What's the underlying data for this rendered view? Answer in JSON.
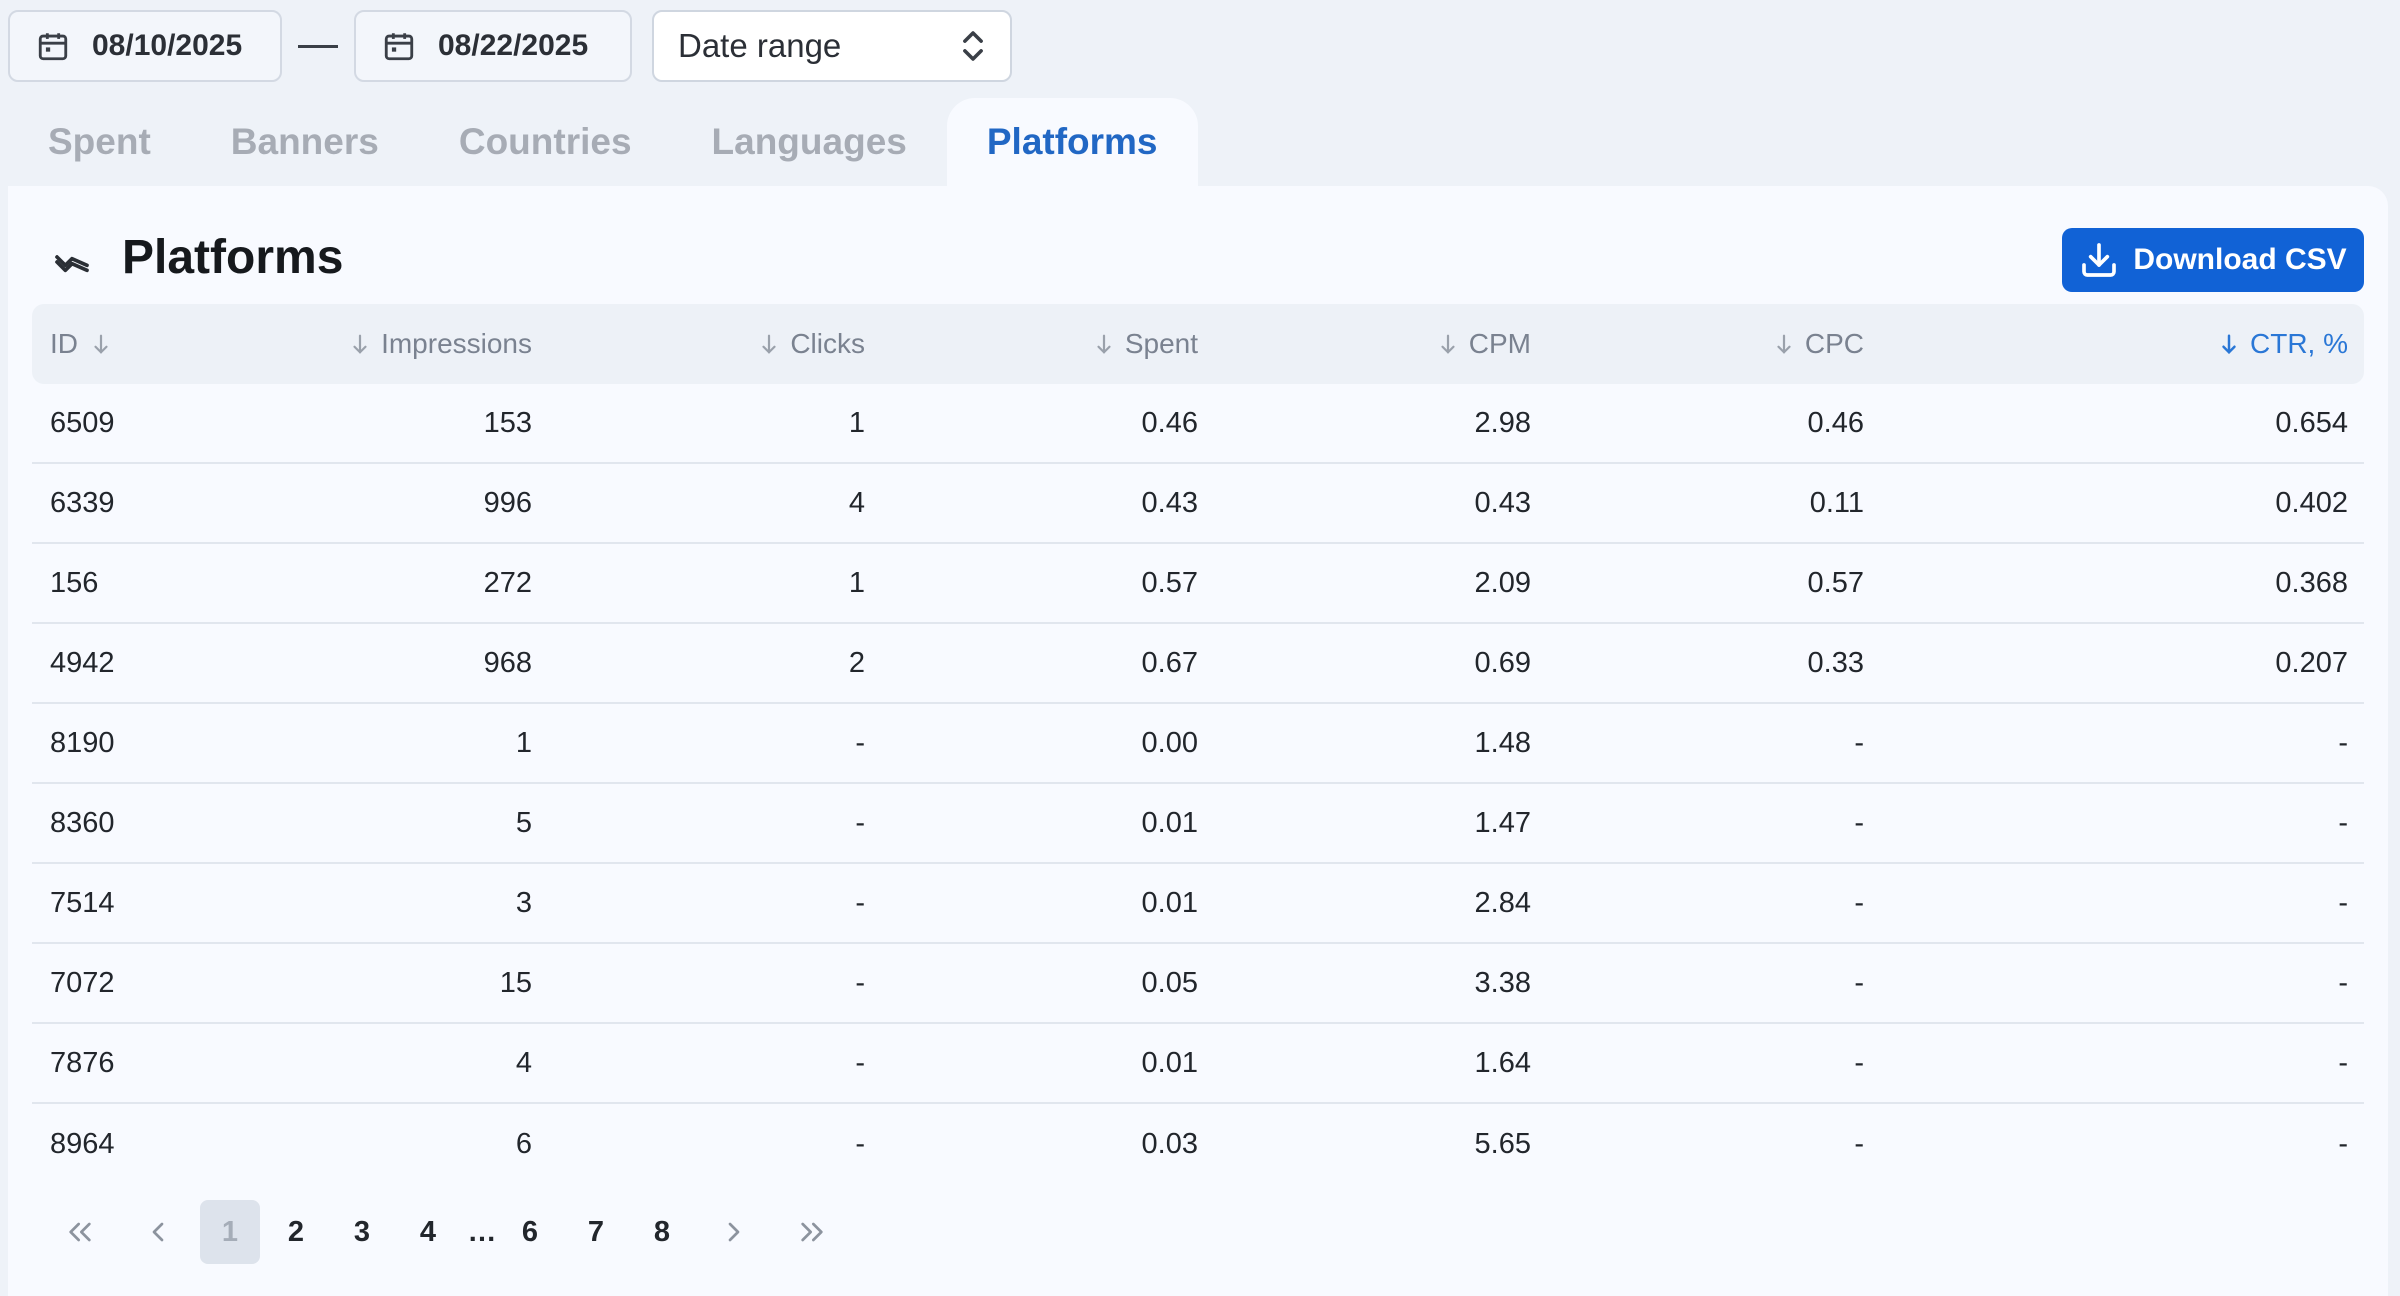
{
  "date_range": {
    "start": "08/10/2025",
    "end": "08/22/2025",
    "select_value": "Date range"
  },
  "tabs": [
    {
      "label": "Spent",
      "active": false
    },
    {
      "label": "Banners",
      "active": false
    },
    {
      "label": "Countries",
      "active": false
    },
    {
      "label": "Languages",
      "active": false
    },
    {
      "label": "Platforms",
      "active": true
    }
  ],
  "panel": {
    "title": "Platforms",
    "download_label": "Download CSV"
  },
  "table": {
    "columns": [
      "ID",
      "Impressions",
      "Clicks",
      "Spent",
      "CPM",
      "CPC",
      "CTR, %"
    ],
    "sorted_column": "CTR, %",
    "rows": [
      [
        "6509",
        "153",
        "1",
        "0.46",
        "2.98",
        "0.46",
        "0.654"
      ],
      [
        "6339",
        "996",
        "4",
        "0.43",
        "0.43",
        "0.11",
        "0.402"
      ],
      [
        "156",
        "272",
        "1",
        "0.57",
        "2.09",
        "0.57",
        "0.368"
      ],
      [
        "4942",
        "968",
        "2",
        "0.67",
        "0.69",
        "0.33",
        "0.207"
      ],
      [
        "8190",
        "1",
        "-",
        "0.00",
        "1.48",
        "-",
        "-"
      ],
      [
        "8360",
        "5",
        "-",
        "0.01",
        "1.47",
        "-",
        "-"
      ],
      [
        "7514",
        "3",
        "-",
        "0.01",
        "2.84",
        "-",
        "-"
      ],
      [
        "7072",
        "15",
        "-",
        "0.05",
        "3.38",
        "-",
        "-"
      ],
      [
        "7876",
        "4",
        "-",
        "0.01",
        "1.64",
        "-",
        "-"
      ],
      [
        "8964",
        "6",
        "-",
        "0.03",
        "5.65",
        "-",
        "-"
      ]
    ]
  },
  "pagination": {
    "pages": [
      "1",
      "2",
      "3",
      "4",
      "6",
      "7",
      "8"
    ],
    "current": "1",
    "ellipsis": "…"
  },
  "colors": {
    "accent": "#1162d6",
    "active_tab": "#2167c4",
    "sorted_header": "#2a77d6"
  }
}
